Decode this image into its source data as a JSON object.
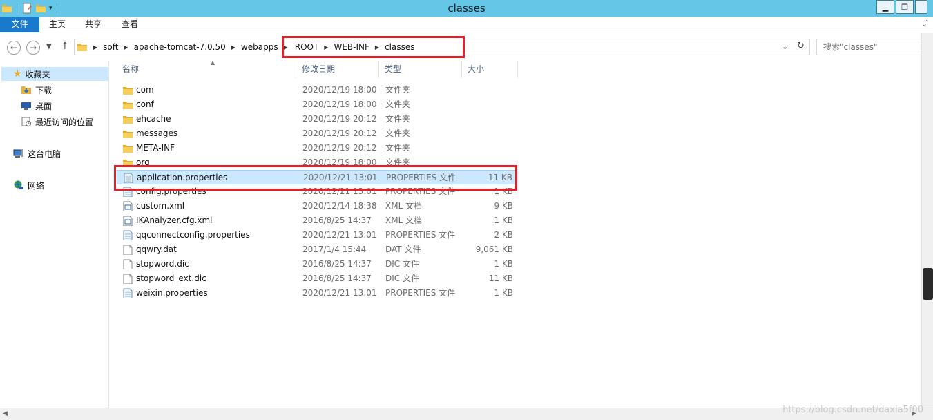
{
  "window": {
    "title": "classes"
  },
  "ribbon": {
    "tabs": [
      "文件",
      "主页",
      "共享",
      "查看"
    ]
  },
  "address": {
    "crumbs": [
      "soft",
      "apache-tomcat-7.0.50",
      "webapps",
      "ROOT",
      "WEB-INF",
      "classes"
    ],
    "search_placeholder": "搜索\"classes\""
  },
  "nav": {
    "favorites": "收藏夹",
    "downloads": "下载",
    "desktop": "桌面",
    "recent": "最近访问的位置",
    "this_pc": "这台电脑",
    "network": "网络"
  },
  "columns": {
    "name": "名称",
    "date": "修改日期",
    "type": "类型",
    "size": "大小"
  },
  "files": [
    {
      "name": "com",
      "date": "2020/12/19 18:00",
      "type": "文件夹",
      "size": "",
      "icon": "folder-icon"
    },
    {
      "name": "conf",
      "date": "2020/12/19 18:00",
      "type": "文件夹",
      "size": "",
      "icon": "folder-icon"
    },
    {
      "name": "ehcache",
      "date": "2020/12/19 20:12",
      "type": "文件夹",
      "size": "",
      "icon": "folder-icon"
    },
    {
      "name": "messages",
      "date": "2020/12/19 20:12",
      "type": "文件夹",
      "size": "",
      "icon": "folder-icon"
    },
    {
      "name": "META-INF",
      "date": "2020/12/19 20:12",
      "type": "文件夹",
      "size": "",
      "icon": "folder-icon"
    },
    {
      "name": "org",
      "date": "2020/12/19 18:00",
      "type": "文件夹",
      "size": "",
      "icon": "folder-icon"
    },
    {
      "name": "application.properties",
      "date": "2020/12/21 13:01",
      "type": "PROPERTIES 文件",
      "size": "11 KB",
      "icon": "properties-file-icon",
      "selected": true
    },
    {
      "name": "config.properties",
      "date": "2020/12/21 13:01",
      "type": "PROPERTIES 文件",
      "size": "1 KB",
      "icon": "properties-file-icon"
    },
    {
      "name": "custom.xml",
      "date": "2020/12/14 18:38",
      "type": "XML 文档",
      "size": "9 KB",
      "icon": "xml-file-icon"
    },
    {
      "name": "IKAnalyzer.cfg.xml",
      "date": "2016/8/25 14:37",
      "type": "XML 文档",
      "size": "1 KB",
      "icon": "xml-file-icon"
    },
    {
      "name": "qqconnectconfig.properties",
      "date": "2020/12/21 13:01",
      "type": "PROPERTIES 文件",
      "size": "2 KB",
      "icon": "properties-file-icon"
    },
    {
      "name": "qqwry.dat",
      "date": "2017/1/4 15:44",
      "type": "DAT 文件",
      "size": "9,061 KB",
      "icon": "file-icon"
    },
    {
      "name": "stopword.dic",
      "date": "2016/8/25 14:37",
      "type": "DIC 文件",
      "size": "1 KB",
      "icon": "file-icon"
    },
    {
      "name": "stopword_ext.dic",
      "date": "2016/8/25 14:37",
      "type": "DIC 文件",
      "size": "11 KB",
      "icon": "file-icon"
    },
    {
      "name": "weixin.properties",
      "date": "2020/12/21 13:01",
      "type": "PROPERTIES 文件",
      "size": "1 KB",
      "icon": "properties-file-icon"
    }
  ],
  "watermark": "https://blog.csdn.net/daxia5f00",
  "colors": {
    "accent": "#1979ca",
    "titlebar": "#66c6e8",
    "selection": "#cce8ff",
    "highlight": "#e0202a"
  }
}
